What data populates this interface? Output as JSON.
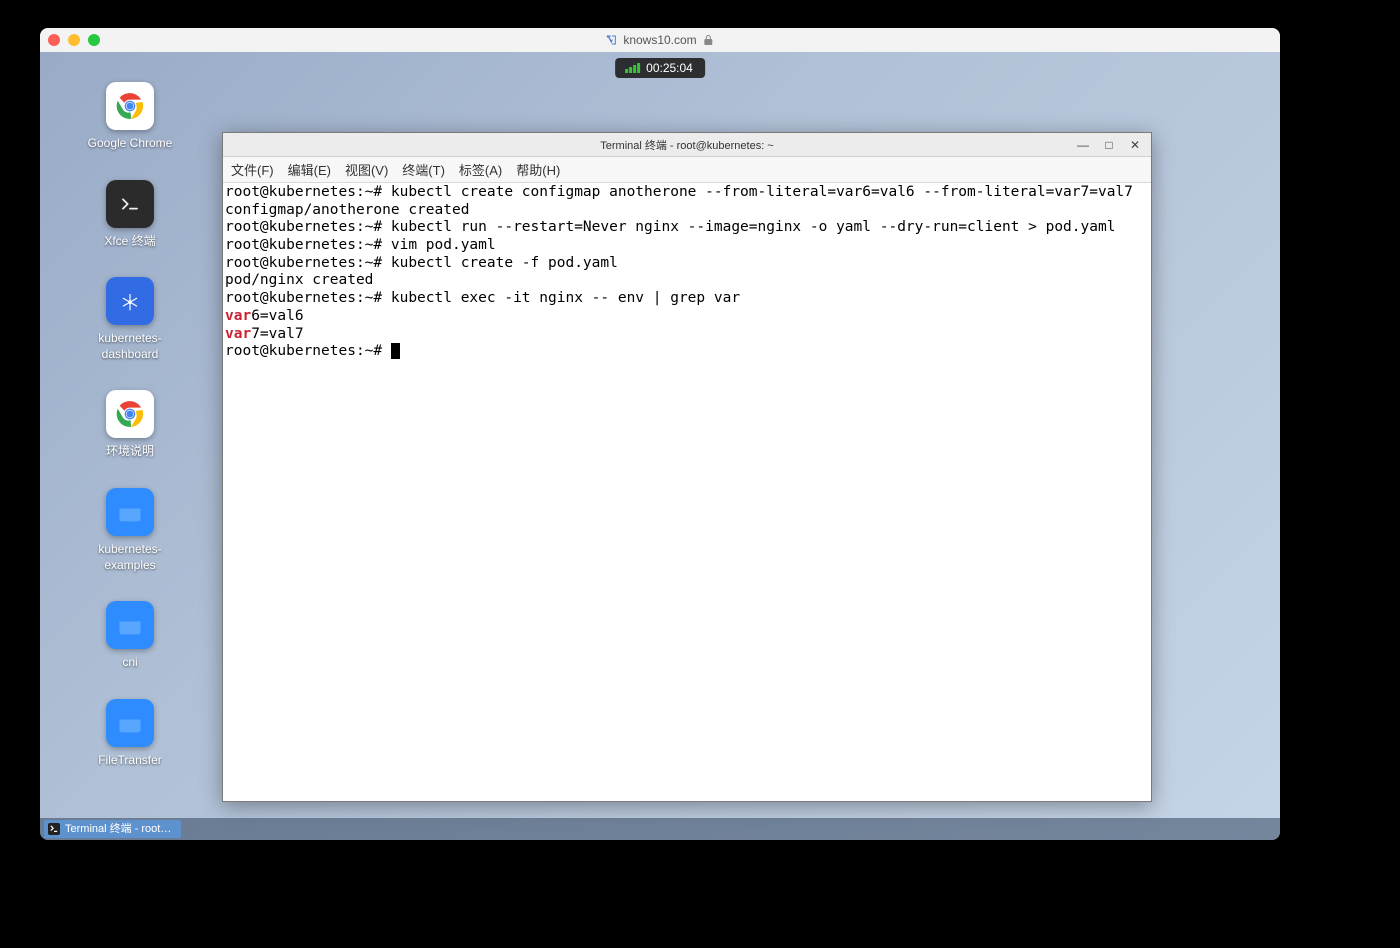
{
  "browser": {
    "url_text": "knows10.com",
    "lock_icon": "lock-icon"
  },
  "timer": {
    "time": "00:25:04"
  },
  "desktop": {
    "icons": [
      {
        "name": "google-chrome",
        "label": "Google Chrome",
        "type": "chrome"
      },
      {
        "name": "xfce-terminal",
        "label": "Xfce 终端",
        "type": "terminal"
      },
      {
        "name": "kubernetes-dashboard",
        "label": "kubernetes-\ndashboard",
        "type": "kube"
      },
      {
        "name": "env-desc",
        "label": "环境说明",
        "type": "chrome"
      },
      {
        "name": "kubernetes-examples",
        "label": "kubernetes-\nexamples",
        "type": "folder"
      },
      {
        "name": "cni",
        "label": "cni",
        "type": "folder"
      },
      {
        "name": "file-transfer",
        "label": "FileTransfer",
        "type": "folder"
      }
    ]
  },
  "terminal": {
    "title": "Terminal 终端 - root@kubernetes: ~",
    "menu": [
      "文件(F)",
      "编辑(E)",
      "视图(V)",
      "终端(T)",
      "标签(A)",
      "帮助(H)"
    ],
    "lines": [
      {
        "prompt": "root@kubernetes:~# ",
        "cmd": "kubectl create configmap anotherone --from-literal=var6=val6 --from-literal=var7=val7"
      },
      {
        "out": "configmap/anotherone created"
      },
      {
        "prompt": "root@kubernetes:~# ",
        "cmd": "kubectl run --restart=Never nginx --image=nginx -o yaml --dry-run=client > pod.yaml"
      },
      {
        "prompt": "root@kubernetes:~# ",
        "cmd": "vim pod.yaml"
      },
      {
        "prompt": "root@kubernetes:~# ",
        "cmd": "kubectl create -f pod.yaml"
      },
      {
        "out": "pod/nginx created"
      },
      {
        "prompt": "root@kubernetes:~# ",
        "cmd": "kubectl exec -it nginx -- env | grep var"
      },
      {
        "hl": "var",
        "rest": "6=val6"
      },
      {
        "hl": "var",
        "rest": "7=val7"
      },
      {
        "prompt": "root@kubernetes:~# ",
        "cursor": true
      }
    ]
  },
  "taskbar": {
    "items": [
      {
        "label": "Terminal 终端 - root…"
      }
    ]
  }
}
